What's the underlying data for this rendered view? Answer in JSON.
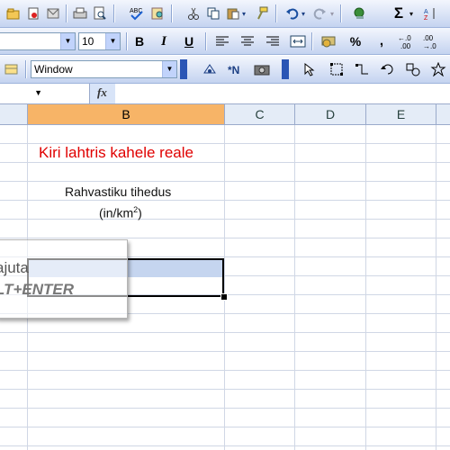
{
  "toolbar_standard": {
    "icons": [
      "open-icon",
      "permission-icon",
      "print-icon",
      "print-preview-icon",
      "spelling-icon",
      "research-icon",
      "cut-icon",
      "copy-icon",
      "paste-icon",
      "format-painter-icon",
      "undo-icon",
      "redo-icon",
      "hyperlink-icon",
      "autosum-icon"
    ],
    "sigma": "Σ"
  },
  "toolbar_formatting": {
    "font_size": "10",
    "bold": "B",
    "italic": "I",
    "underline": "U",
    "percent": "%",
    "comma": ",",
    "inc_decimal": "+.0 .00",
    "dec_decimal": ".00 +.0"
  },
  "toolbar_drawing": {
    "font_name": "Window"
  },
  "formula_bar": {
    "fx": "fx",
    "name_box": "",
    "content": ""
  },
  "columns": [
    "B",
    "C",
    "D",
    "E"
  ],
  "selected_column": "B",
  "cells": {
    "title": "Kiri lahtris kahele reale",
    "label_line1": "Rahvastiku tihedus",
    "label_line2_pre": "(in/km",
    "label_line2_sup": "2",
    "label_line2_post": ")"
  },
  "tooltip": {
    "line1": "ajuta",
    "line2": "LT+ENTER"
  }
}
